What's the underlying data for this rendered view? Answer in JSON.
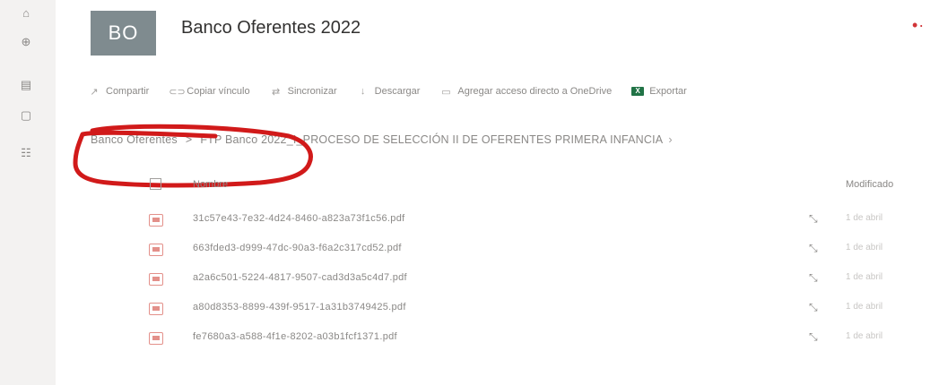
{
  "site": {
    "logo_text": "BO",
    "title": "Banco Oferentes 2022"
  },
  "commands": [
    {
      "label": "Compartir",
      "icon": "share-icon"
    },
    {
      "label": "Copiar vínculo",
      "icon": "link-icon"
    },
    {
      "label": "Sincronizar",
      "icon": "sync-icon"
    },
    {
      "label": "Descargar",
      "icon": "download-icon"
    },
    {
      "label": "Agregar acceso directo a OneDrive",
      "icon": "shortcut-icon"
    },
    {
      "label": "Exportar",
      "icon": "excel-icon"
    }
  ],
  "breadcrumb": {
    "root": "Banco Oferentes",
    "separator": ">",
    "current": "FTP Banco 2022_I_PROCESO DE SELECCIÓN II DE OFERENTES PRIMERA INFANCIA",
    "more": "›"
  },
  "columns": {
    "name": "Nombre",
    "modified": "Modificado"
  },
  "files": [
    {
      "name": "31c57e43-7e32-4d24-8460-a823a73f1c56.pdf",
      "modified": "1 de abril"
    },
    {
      "name": "663fded3-d999-47dc-90a3-f6a2c317cd52.pdf",
      "modified": "1 de abril"
    },
    {
      "name": "a2a6c501-5224-4817-9507-cad3d3a5c4d7.pdf",
      "modified": "1 de abril"
    },
    {
      "name": "a80d8353-8899-439f-9517-1a31b3749425.pdf",
      "modified": "1 de abril"
    },
    {
      "name": "fe7680a3-a588-4f1e-8202-a03b1fcf1371.pdf",
      "modified": "1 de abril"
    }
  ],
  "colors": {
    "accent_red": "#d13438",
    "excel_green": "#217346",
    "logo_bg": "#7f8b8f"
  }
}
